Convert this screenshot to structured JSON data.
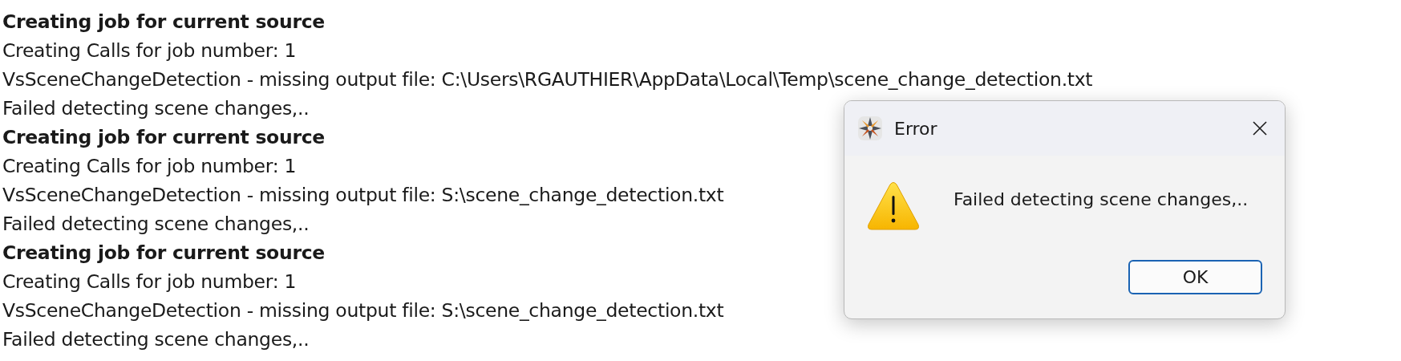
{
  "log": [
    {
      "kind": "heading",
      "text": "Creating job for current source"
    },
    {
      "kind": "plain",
      "text": "Creating Calls for job number: 1"
    },
    {
      "kind": "plain",
      "text": "VsSceneChangeDetection - missing output file: C:\\Users\\RGAUTHIER\\AppData\\Local\\Temp\\scene_change_detection.txt"
    },
    {
      "kind": "plain",
      "text": "Failed detecting scene changes,.."
    },
    {
      "kind": "heading",
      "text": "Creating job for current source"
    },
    {
      "kind": "plain",
      "text": "Creating Calls for job number: 1"
    },
    {
      "kind": "plain",
      "text": "VsSceneChangeDetection - missing output file: S:\\scene_change_detection.txt"
    },
    {
      "kind": "plain",
      "text": "Failed detecting scene changes,.."
    },
    {
      "kind": "heading",
      "text": "Creating job for current source"
    },
    {
      "kind": "plain",
      "text": "Creating Calls for job number: 1"
    },
    {
      "kind": "plain",
      "text": "VsSceneChangeDetection - missing output file: S:\\scene_change_detection.txt"
    },
    {
      "kind": "plain",
      "text": "Failed detecting scene changes,.."
    }
  ],
  "dialog": {
    "title": "Error",
    "message": "Failed detecting scene changes,..",
    "buttons": [
      "OK"
    ]
  }
}
